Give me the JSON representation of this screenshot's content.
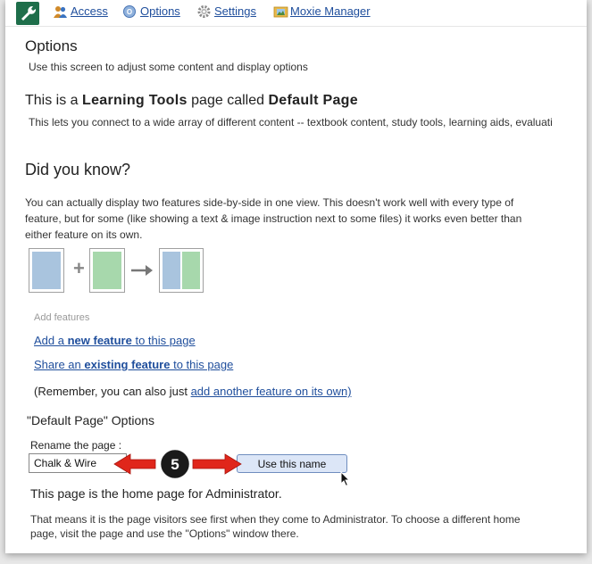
{
  "toolbar": {
    "items": [
      {
        "label": "Access",
        "icon": "people-icon"
      },
      {
        "label": "Options",
        "icon": "options-icon"
      },
      {
        "label": "Settings",
        "icon": "gear-icon"
      },
      {
        "label": "Moxie Manager",
        "icon": "folder-image-icon"
      }
    ],
    "app_icon": "wrench-icon"
  },
  "options": {
    "title": "Options",
    "subtitle": "Use this screen to adjust some content and display options"
  },
  "learning_tools": {
    "heading_prefix": "This is a ",
    "heading_bold1": "Learning Tools",
    "heading_mid": " page called ",
    "heading_bold2": "Default Page",
    "description": "This lets you connect to a wide array of different content -- textbook content, study tools, learning aids, evaluati"
  },
  "did_you_know": {
    "title": "Did you know?",
    "text": "You can actually display two features side-by-side in one view. This doesn't work well with every type of feature, but for some (like showing a text & image instruction next to some files) it works even better than either feature on its own."
  },
  "add_features": {
    "label": "Add features",
    "new_link": {
      "pre": "Add a ",
      "bold": "new feature",
      "post": " to this page"
    },
    "existing_link": {
      "pre": "Share an ",
      "bold": "existing feature",
      "post": " to this page"
    },
    "remember_pre": "(Remember, you can also just ",
    "remember_link": "add another feature on its own)"
  },
  "default_page_options": {
    "title": "\"Default Page\" Options",
    "rename_label": "Rename the page :",
    "rename_value": "Chalk & Wire",
    "button_label": "Use this name",
    "callout_number": "5"
  },
  "home_page": {
    "heading": "This page is the home page for Administrator.",
    "text": "That means it is the page visitors see first when they come to Administrator. To choose a different home page, visit the page and use the \"Options\" window there."
  },
  "colors": {
    "link": "#1f4e9c",
    "brand_tile": "#1e6e4a",
    "diagram_blue": "#a9c4de",
    "diagram_green": "#a7d8ac",
    "callout_arrow": "#e0261b"
  }
}
